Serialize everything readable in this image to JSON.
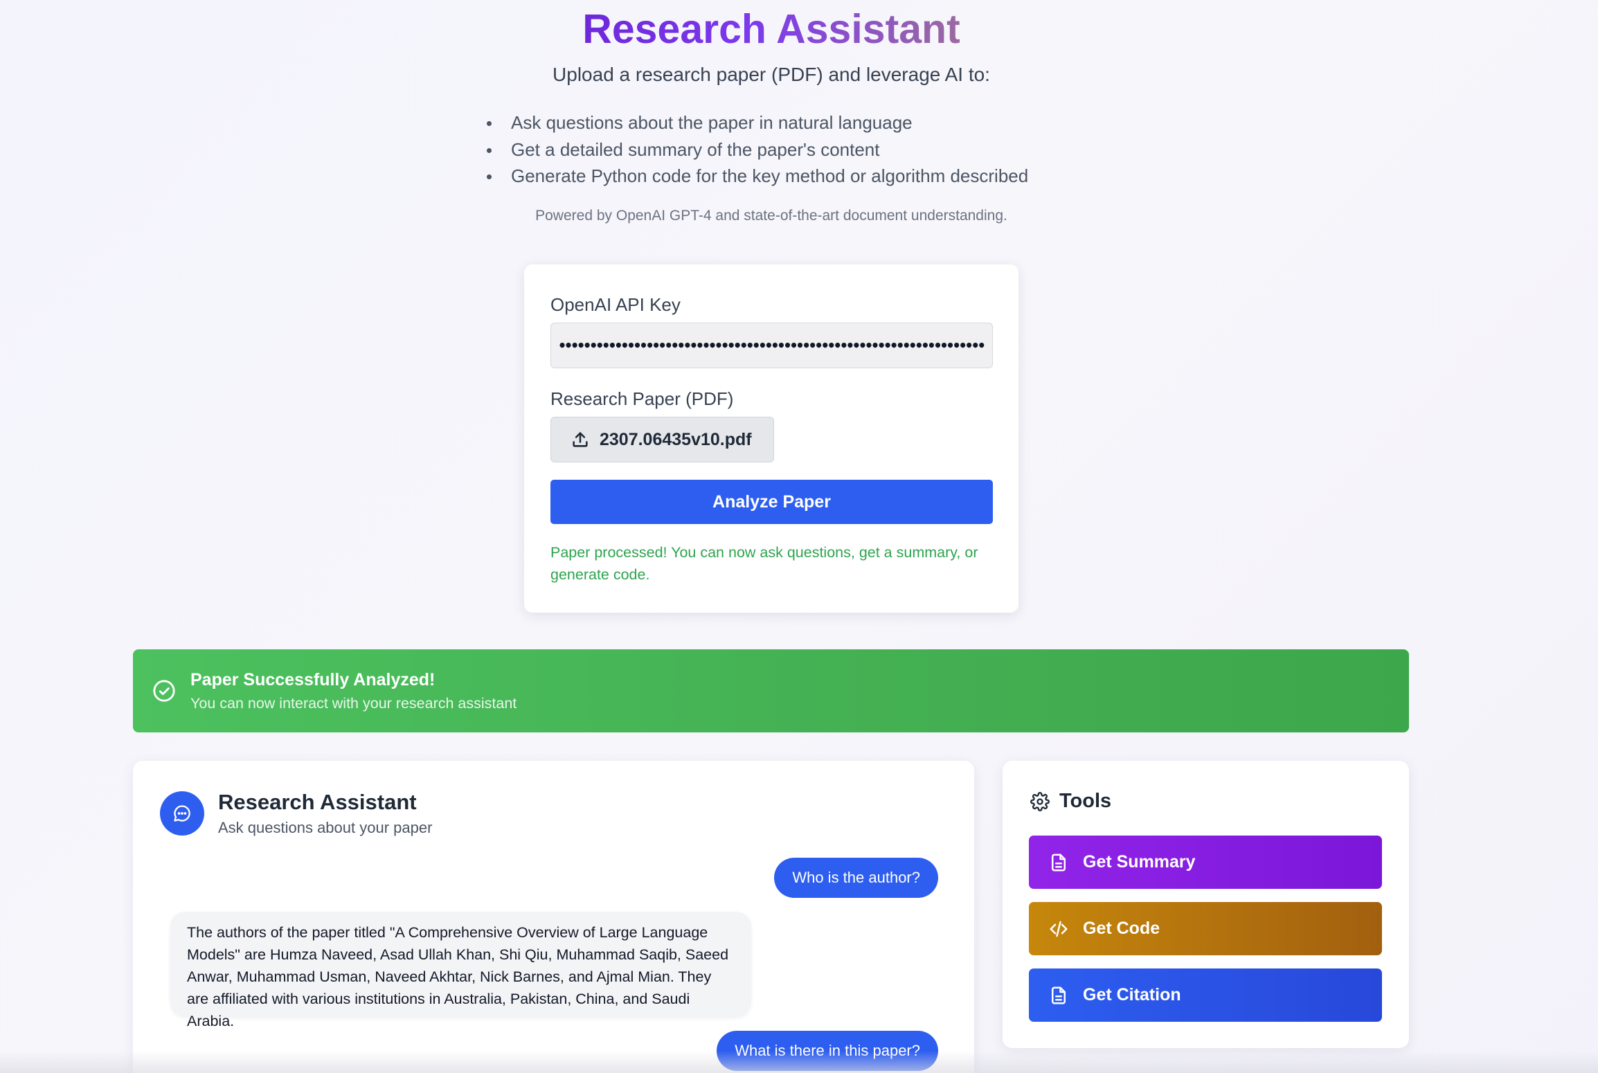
{
  "header": {
    "title": "Research Assistant",
    "subtitle": "Upload a research paper (PDF) and leverage AI to:",
    "features": [
      "Ask questions about the paper in natural language",
      "Get a detailed summary of the paper's content",
      "Generate Python code for the key method or algorithm described"
    ],
    "powered_by": "Powered by OpenAI GPT-4 and state-of-the-art document understanding."
  },
  "upload_form": {
    "api_key_label": "OpenAI API Key",
    "api_key_value": "••••••••••••••••••••••••••••••••••••••••••••••••••••••••••••••••••••",
    "pdf_label": "Research Paper (PDF)",
    "file_name": "2307.06435v10.pdf",
    "analyze_button": "Analyze Paper",
    "status_message": "Paper processed! You can now ask questions, get a summary, or generate code."
  },
  "banner": {
    "title": "Paper Successfully Analyzed!",
    "subtitle": "You can now interact with your research assistant",
    "color": "#44b153"
  },
  "chat": {
    "title": "Research Assistant",
    "subtitle": "Ask questions about your paper",
    "messages": [
      {
        "role": "user",
        "text": "Who is the author?"
      },
      {
        "role": "assistant",
        "text": "The authors of the paper titled \"A Comprehensive Overview of Large Language Models\" are Humza Naveed, Asad Ullah Khan, Shi Qiu, Muhammad Saqib, Saeed Anwar, Muhammad Usman, Naveed Akhtar, Nick Barnes, and Ajmal Mian. They are affiliated with various institutions in Australia, Pakistan, China, and Saudi Arabia."
      },
      {
        "role": "user",
        "text": "What is there in this paper?"
      }
    ]
  },
  "tools": {
    "title": "Tools",
    "buttons": [
      {
        "label": "Get Summary",
        "icon": "document-icon",
        "color": "#8b1fe3"
      },
      {
        "label": "Get Code",
        "icon": "code-icon",
        "color": "#b3740d"
      },
      {
        "label": "Get Citation",
        "icon": "document-icon",
        "color": "#2d5ef0"
      }
    ]
  },
  "colors": {
    "accent": "#2d5ef0",
    "title_gradient_start": "#6d28d9",
    "success": "#2da44e"
  }
}
